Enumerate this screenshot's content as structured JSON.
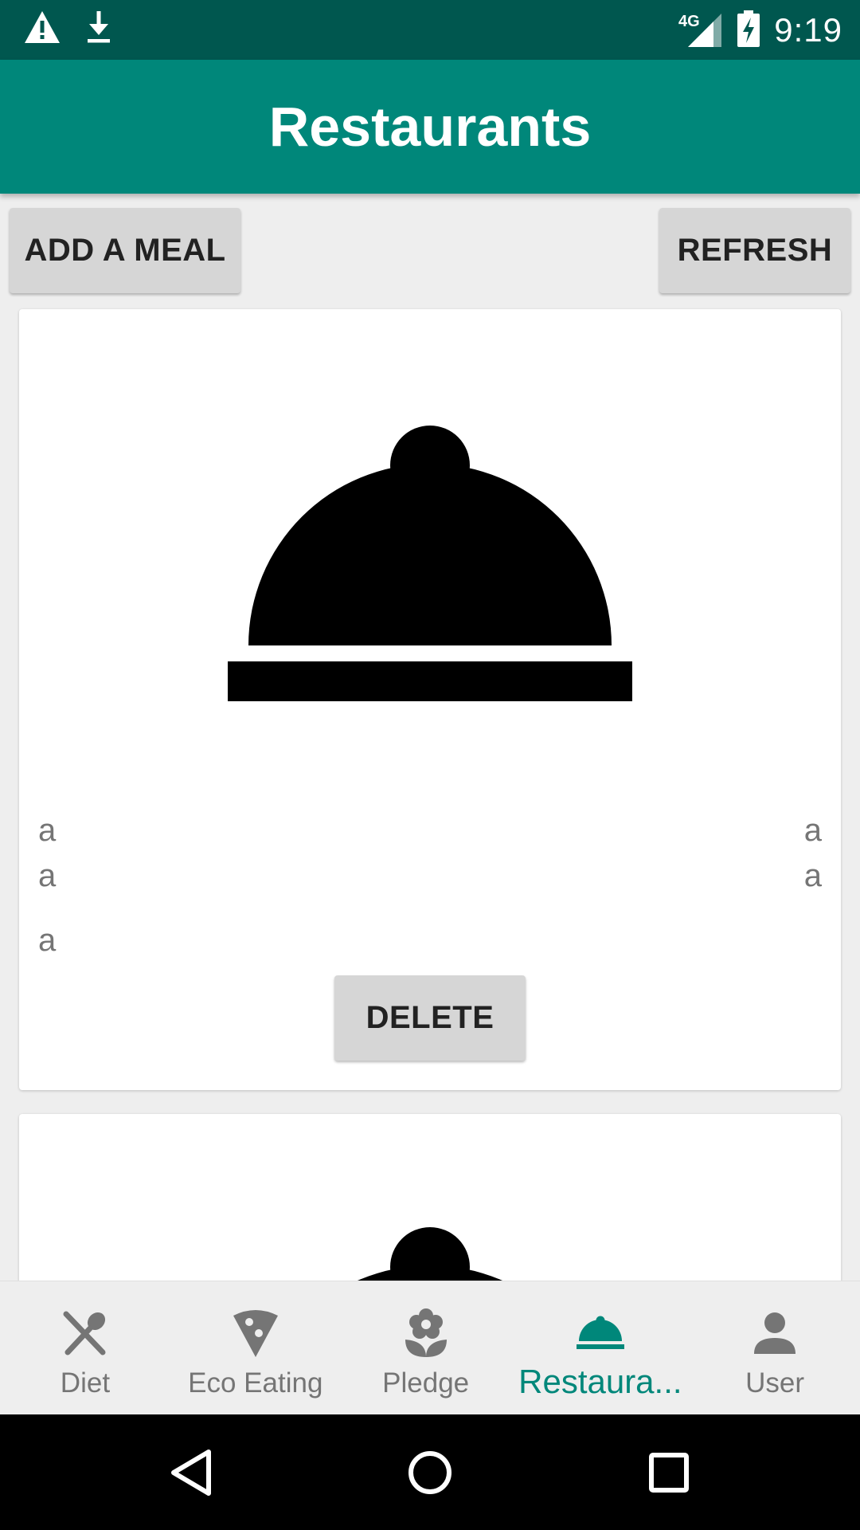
{
  "status_bar": {
    "time": "9:19",
    "network": "4G",
    "icons": [
      "warning-icon",
      "download-icon",
      "signal-icon",
      "battery-charging-icon"
    ]
  },
  "app_bar": {
    "title": "Restaurants"
  },
  "toolbar": {
    "add_label": "ADD A MEAL",
    "refresh_label": "REFRESH"
  },
  "cards": [
    {
      "image_icon": "cloche-icon",
      "left_fields": [
        "a",
        "a",
        "a"
      ],
      "right_fields": [
        "a",
        "a"
      ],
      "delete_label": "DELETE"
    },
    {
      "image_icon": "cloche-icon"
    }
  ],
  "bottom_nav": {
    "items": [
      {
        "label": "Diet",
        "icon": "fork-spoon-icon",
        "active": false
      },
      {
        "label": "Eco Eating",
        "icon": "pizza-slice-icon",
        "active": false
      },
      {
        "label": "Pledge",
        "icon": "flower-icon",
        "active": false
      },
      {
        "label": "Restaura...",
        "icon": "cloche-icon",
        "active": true
      },
      {
        "label": "User",
        "icon": "person-icon",
        "active": false
      }
    ]
  },
  "system_nav": [
    "back-icon",
    "home-icon",
    "recents-icon"
  ],
  "colors": {
    "status_bar": "#00574f",
    "primary": "#00877a",
    "button_bg": "#d6d6d6",
    "inactive_nav": "#757575",
    "background": "#eeeeee"
  }
}
